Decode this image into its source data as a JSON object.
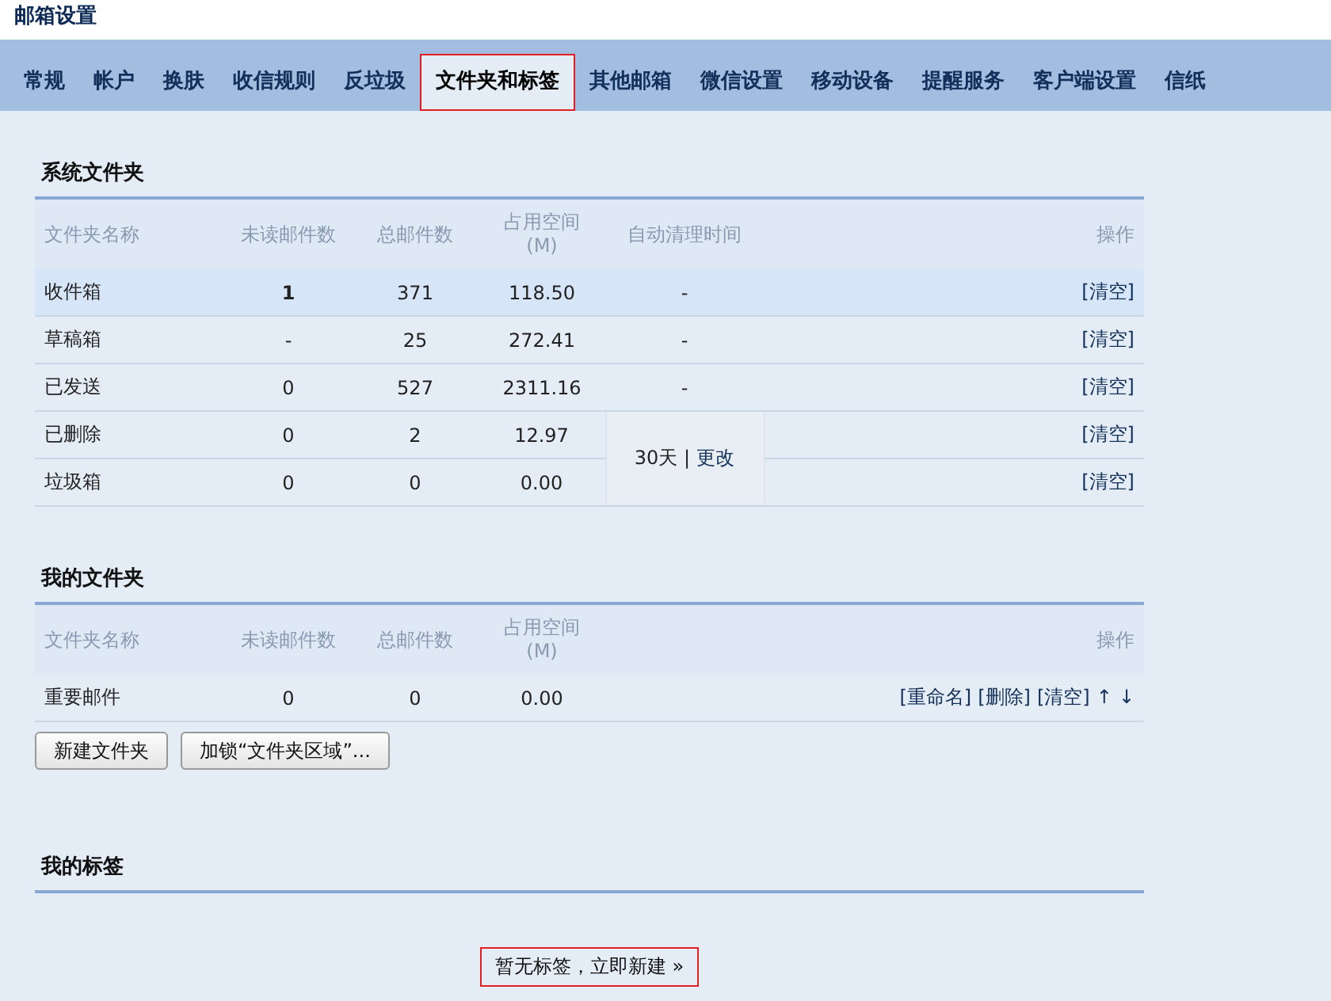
{
  "page_title": "邮箱设置",
  "tabs": [
    {
      "label": "常规",
      "selected": false
    },
    {
      "label": "帐户",
      "selected": false
    },
    {
      "label": "换肤",
      "selected": false
    },
    {
      "label": "收信规则",
      "selected": false
    },
    {
      "label": "反垃圾",
      "selected": false
    },
    {
      "label": "文件夹和标签",
      "selected": true
    },
    {
      "label": "其他邮箱",
      "selected": false
    },
    {
      "label": "微信设置",
      "selected": false
    },
    {
      "label": "移动设备",
      "selected": false
    },
    {
      "label": "提醒服务",
      "selected": false
    },
    {
      "label": "客户端设置",
      "selected": false
    },
    {
      "label": "信纸",
      "selected": false
    }
  ],
  "system_folders": {
    "title": "系统文件夹",
    "columns": [
      "文件夹名称",
      "未读邮件数",
      "总邮件数",
      "占用空间\n(M)",
      "自动清理时间",
      "操作"
    ],
    "rows": [
      {
        "name": "收件箱",
        "unread": "1",
        "total": "371",
        "size": "118.50",
        "auto_clean": "-",
        "actions": [
          "[清空]"
        ],
        "highlighted": true
      },
      {
        "name": "草稿箱",
        "unread": "-",
        "total": "25",
        "size": "272.41",
        "auto_clean": "-",
        "actions": [
          "[清空]"
        ],
        "highlighted": false
      },
      {
        "name": "已发送",
        "unread": "0",
        "total": "527",
        "size": "2311.16",
        "auto_clean": "-",
        "actions": [
          "[清空]"
        ],
        "highlighted": false
      },
      {
        "name": "已删除",
        "unread": "0",
        "total": "2",
        "size": "12.97",
        "actions": [
          "[清空]"
        ],
        "highlighted": false
      },
      {
        "name": "垃圾箱",
        "unread": "0",
        "total": "0",
        "size": "0.00",
        "actions": [
          "[清空]"
        ],
        "highlighted": false
      }
    ],
    "shared_auto_clean": {
      "days": "30天",
      "separator": "|",
      "link": "更改"
    }
  },
  "my_folders": {
    "title": "我的文件夹",
    "columns": [
      "文件夹名称",
      "未读邮件数",
      "总邮件数",
      "占用空间\n(M)",
      "操作"
    ],
    "rows": [
      {
        "name": "重要邮件",
        "unread": "0",
        "total": "0",
        "size": "0.00",
        "actions": [
          "[重命名]",
          "[删除]",
          "[清空]",
          "↑",
          "↓"
        ]
      }
    ],
    "buttons": [
      "新建文件夹",
      "加锁“文件夹区域”..."
    ]
  },
  "my_tags": {
    "title": "我的标签",
    "empty_link": "暂无标签，立即新建 »"
  }
}
